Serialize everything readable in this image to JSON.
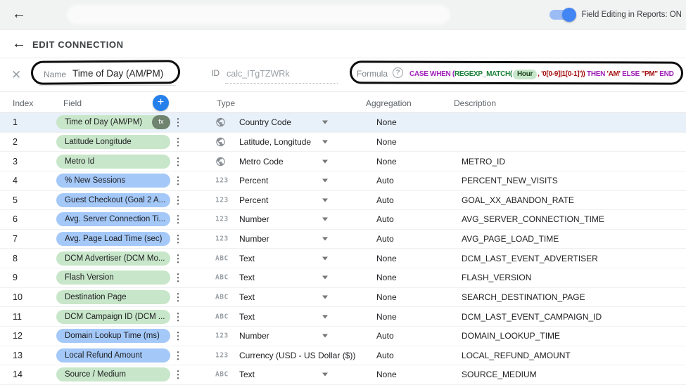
{
  "topbar": {
    "toggle_label": "Field Editing in Reports: ON",
    "toggle_state": "on"
  },
  "connection_bar": {
    "title": "EDIT CONNECTION"
  },
  "icons": {
    "back": "←",
    "close": "✕",
    "help": "?",
    "add": "+",
    "kebab": "⋮",
    "fx_label": "fx",
    "numeric_label": "123",
    "text_label": "ABC"
  },
  "colors": {
    "accent_blue": "#2680eb",
    "toggle_blue": "#4285f4",
    "dimension_green": "#c8e6c9",
    "metric_blue": "#a4c8f8",
    "selected_row": "#e8f1fa",
    "keyword_purple": "#a01fb8",
    "function_green": "#188038",
    "string_red": "#a50e0e"
  },
  "editor": {
    "name_label": "Name",
    "name_value": "Time of Day (AM/PM)",
    "id_label": "ID",
    "id_value": "calc_ITgTZWRk",
    "formula_label": "Formula",
    "formula_segments": [
      {
        "text": "CASE WHEN (",
        "style": "kw"
      },
      {
        "text": "REGEXP_MATCH(",
        "style": "fn"
      },
      {
        "text": "Hour",
        "style": "chip"
      },
      {
        "text": ", ",
        "style": "str"
      },
      {
        "text": "'0[0-9]|1[0-1]'",
        "style": "str"
      },
      {
        "text": "))",
        "style": "str"
      },
      {
        "text": " THEN ",
        "style": "kw"
      },
      {
        "text": "'AM'",
        "style": "str"
      },
      {
        "text": " ELSE ",
        "style": "kw"
      },
      {
        "text": "\"PM\"",
        "style": "str"
      },
      {
        "text": " END",
        "style": "kw"
      }
    ]
  },
  "table": {
    "columns": {
      "index": "Index",
      "field": "Field",
      "type": "Type",
      "aggregation": "Aggregation",
      "description": "Description"
    },
    "rows": [
      {
        "index": "1",
        "field": "Time of Day (AM/PM)",
        "kind": "dimension",
        "fx": true,
        "type_icon": "globe",
        "type": "Country Code",
        "dropdown": true,
        "aggregation": "None",
        "description": "",
        "selected": true
      },
      {
        "index": "2",
        "field": "Latitude Longitude",
        "kind": "dimension",
        "fx": false,
        "type_icon": "globe",
        "type": "Latitude, Longitude",
        "dropdown": true,
        "aggregation": "None",
        "description": "",
        "selected": false
      },
      {
        "index": "3",
        "field": "Metro Id",
        "kind": "dimension",
        "fx": false,
        "type_icon": "globe",
        "type": "Metro Code",
        "dropdown": true,
        "aggregation": "None",
        "description": "METRO_ID",
        "selected": false
      },
      {
        "index": "4",
        "field": "% New Sessions",
        "kind": "metric",
        "fx": false,
        "type_icon": "numeric",
        "type": "Percent",
        "dropdown": true,
        "aggregation": "Auto",
        "description": "PERCENT_NEW_VISITS",
        "selected": false
      },
      {
        "index": "5",
        "field": "Guest Checkout (Goal 2 A...",
        "kind": "metric",
        "fx": false,
        "type_icon": "numeric",
        "type": "Percent",
        "dropdown": true,
        "aggregation": "Auto",
        "description": "GOAL_XX_ABANDON_RATE",
        "selected": false
      },
      {
        "index": "6",
        "field": "Avg. Server Connection Ti...",
        "kind": "metric",
        "fx": false,
        "type_icon": "numeric",
        "type": "Number",
        "dropdown": true,
        "aggregation": "Auto",
        "description": "AVG_SERVER_CONNECTION_TIME",
        "selected": false
      },
      {
        "index": "7",
        "field": "Avg. Page Load Time (sec)",
        "kind": "metric",
        "fx": false,
        "type_icon": "numeric",
        "type": "Number",
        "dropdown": true,
        "aggregation": "Auto",
        "description": "AVG_PAGE_LOAD_TIME",
        "selected": false
      },
      {
        "index": "8",
        "field": "DCM Advertiser (DCM Mo...",
        "kind": "dimension",
        "fx": false,
        "type_icon": "text",
        "type": "Text",
        "dropdown": true,
        "aggregation": "None",
        "description": "DCM_LAST_EVENT_ADVERTISER",
        "selected": false
      },
      {
        "index": "9",
        "field": "Flash Version",
        "kind": "dimension",
        "fx": false,
        "type_icon": "text",
        "type": "Text",
        "dropdown": true,
        "aggregation": "None",
        "description": "FLASH_VERSION",
        "selected": false
      },
      {
        "index": "10",
        "field": "Destination Page",
        "kind": "dimension",
        "fx": false,
        "type_icon": "text",
        "type": "Text",
        "dropdown": true,
        "aggregation": "None",
        "description": "SEARCH_DESTINATION_PAGE",
        "selected": false
      },
      {
        "index": "11",
        "field": "DCM Campaign ID (DCM ...",
        "kind": "dimension",
        "fx": false,
        "type_icon": "text",
        "type": "Text",
        "dropdown": true,
        "aggregation": "None",
        "description": "DCM_LAST_EVENT_CAMPAIGN_ID",
        "selected": false
      },
      {
        "index": "12",
        "field": "Domain Lookup Time (ms)",
        "kind": "metric",
        "fx": false,
        "type_icon": "numeric",
        "type": "Number",
        "dropdown": true,
        "aggregation": "Auto",
        "description": "DOMAIN_LOOKUP_TIME",
        "selected": false
      },
      {
        "index": "13",
        "field": "Local Refund Amount",
        "kind": "metric",
        "fx": false,
        "type_icon": "numeric",
        "type": "Currency (USD - US Dollar ($))",
        "dropdown": false,
        "aggregation": "Auto",
        "description": "LOCAL_REFUND_AMOUNT",
        "selected": false
      },
      {
        "index": "14",
        "field": "Source / Medium",
        "kind": "dimension",
        "fx": false,
        "type_icon": "text",
        "type": "Text",
        "dropdown": true,
        "aggregation": "None",
        "description": "SOURCE_MEDIUM",
        "selected": false
      }
    ]
  }
}
